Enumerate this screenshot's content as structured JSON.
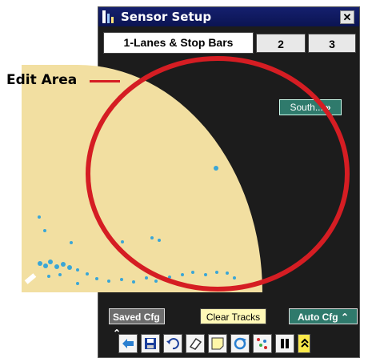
{
  "window": {
    "title": "Sensor Setup",
    "close_label": "✕"
  },
  "tabs": [
    {
      "label": "1-Lanes & Stop Bars",
      "active": true
    },
    {
      "label": "2",
      "active": false
    },
    {
      "label": "3",
      "active": false
    }
  ],
  "edit_area": {
    "south_button": {
      "label": "South...",
      "chevron": "»"
    }
  },
  "buttons": {
    "saved_cfg": "Saved Cfg ⌃",
    "clear_tracks": "Clear Tracks",
    "auto_cfg": "Auto Cfg ⌃"
  },
  "toolbar_icons": [
    "back-arrow-icon",
    "save-icon",
    "undo-icon",
    "eraser-icon",
    "note-icon",
    "refresh-icon",
    "dots-icon",
    "pause-icon",
    "expand-icon"
  ],
  "annotation": {
    "label": "Edit Area",
    "color": "#d51d23"
  },
  "colors": {
    "edit_fill": "#f2dfa1",
    "accent_teal": "#2f7a6c",
    "title_bar": "#15206e"
  }
}
